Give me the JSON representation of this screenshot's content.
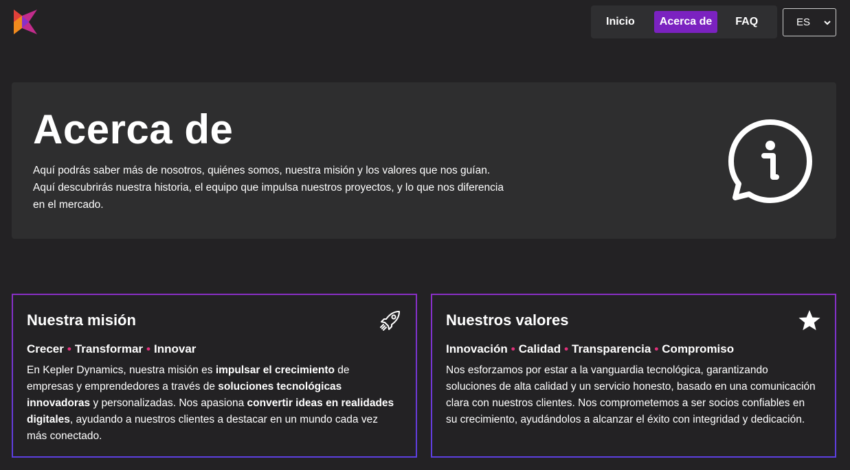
{
  "nav": {
    "items": [
      {
        "label": "Inicio",
        "active": false
      },
      {
        "label": "Acerca de",
        "active": true
      },
      {
        "label": "FAQ",
        "active": false
      }
    ],
    "language": "ES"
  },
  "hero": {
    "title": "Acerca de",
    "description": "Aquí podrás saber más de nosotros, quiénes somos, nuestra misión y los valores que nos guían. Aquí descubrirás nuestra historia, el equipo que impulsa nuestros proyectos, y lo que nos diferencia en el mercado.",
    "icon": "info-chat-icon"
  },
  "mission": {
    "title": "Nuestra misión",
    "icon": "rocket-icon",
    "tags": [
      "Crecer",
      "Transformar",
      "Innovar"
    ],
    "body": {
      "p1": "En Kepler Dynamics, nuestra misión es ",
      "b1": "impulsar el crecimiento",
      "p2": " de empresas y emprendedores a través de ",
      "b2": "soluciones tecnológicas innovadoras",
      "p3": " y personalizadas. Nos apasiona ",
      "b3": "convertir ideas en realidades digitales",
      "p4": ", ayudando a nuestros clientes a destacar en un mundo cada vez más conectado."
    }
  },
  "values": {
    "title": "Nuestros valores",
    "icon": "star-icon",
    "tags": [
      "Innovación",
      "Calidad",
      "Transparencia",
      "Compromiso"
    ],
    "body": "Nos esforzamos por estar a la vanguardia tecnológica, garantizando soluciones de alta calidad y un servicio honesto, basado en una comunicación clara con nuestros clientes. Nos comprometemos a ser socios confiables en su crecimiento, ayudándolos a alcanzar el éxito con integridad y dedicación."
  },
  "colors": {
    "background": "#232224",
    "panel": "#2e2e2f",
    "accent": "#7b22c0",
    "dot": "#e0307a"
  }
}
